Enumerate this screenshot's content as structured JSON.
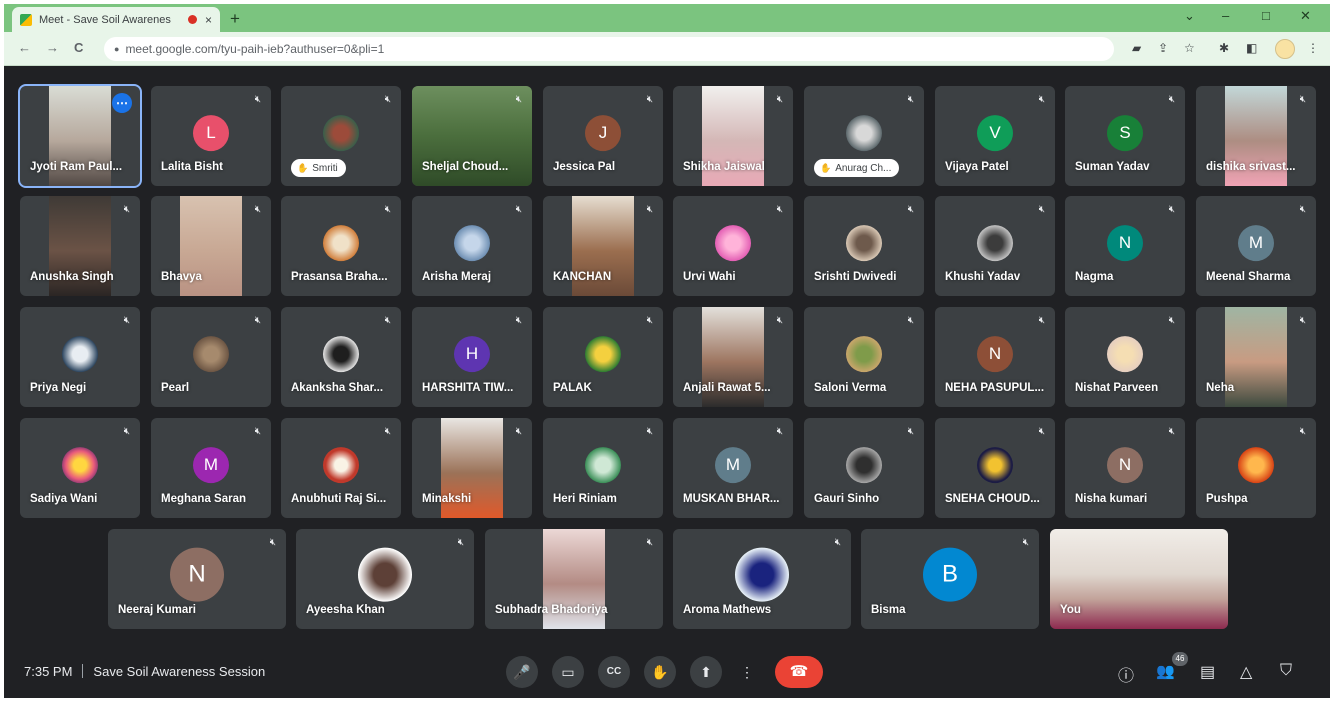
{
  "browser": {
    "tab_title": "Meet - Save Soil Awarenes",
    "url": "meet.google.com/tyu-paih-ieb?authuser=0&pli=1",
    "tab_close": "×",
    "new_tab": "+",
    "window_controls": {
      "collapse": "⌄",
      "minimize": "–",
      "maximize": "□",
      "close": "✕"
    },
    "nav": {
      "back": "←",
      "forward": "→",
      "reload": "C"
    },
    "toolbar_icons": {
      "cast": "▰",
      "share": "⇪",
      "bookmark": "☆",
      "extensions": "✱",
      "sidepanel": "◧",
      "menu": "⋮"
    }
  },
  "participants": [
    {
      "name": "Jyoti Ram Paul...",
      "kind": "video",
      "bg": "linear-gradient(180deg,#d9dcd5,#b6a89c 55%,#514844)",
      "active": true
    },
    {
      "name": "Lalita Bisht",
      "kind": "avatar",
      "initial": "L",
      "color": "#e8506b"
    },
    {
      "name": "Smriti",
      "kind": "photo-pill",
      "bg": "radial-gradient(circle,#9c4b3a 30%,#3a5f4a 70%)"
    },
    {
      "name": "Sheljal Choud...",
      "kind": "video-full",
      "bg": "linear-gradient(180deg,#6d8f5e,#4b6e3d 50%,#2f4b28)"
    },
    {
      "name": "Jessica Pal",
      "kind": "avatar",
      "initial": "J",
      "color": "#8d4f37"
    },
    {
      "name": "Shikha Jaiswal",
      "kind": "video",
      "bg": "linear-gradient(180deg,#f1f0ee,#d4b7b6 55%,#e8a9b6)"
    },
    {
      "name": "Anurag Ch...",
      "kind": "photo-pill",
      "bg": "radial-gradient(circle,#d8d8d8 30%,#5e6a6e 70%)"
    },
    {
      "name": "Vijaya Patel",
      "kind": "avatar",
      "initial": "V",
      "color": "#0f9d58"
    },
    {
      "name": "Suman Yadav",
      "kind": "avatar",
      "initial": "S",
      "color": "#188038"
    },
    {
      "name": "dishika srivast...",
      "kind": "video",
      "bg": "linear-gradient(180deg,#c2d7d8,#ad8d82 55%,#f0a3b5)"
    },
    {
      "name": "Anushka Singh",
      "kind": "video",
      "bg": "linear-gradient(180deg,#3f3a36,#6b5346 55%,#2b2624)"
    },
    {
      "name": "Bhavya",
      "kind": "video",
      "bg": "linear-gradient(180deg,#d8c2b0,#c8a894 55%,#b99283)"
    },
    {
      "name": "Prasansa Braha...",
      "kind": "photo",
      "bg": "radial-gradient(circle,#f0e1c8 30%,#d17f3c 70%)"
    },
    {
      "name": "Arisha Meraj",
      "kind": "photo",
      "bg": "radial-gradient(circle,#c5d6ea 30%,#6e8fb3 70%)"
    },
    {
      "name": "KANCHAN",
      "kind": "video",
      "bg": "linear-gradient(180deg,#e6ddd0,#9b6e4f 55%,#6b4a38)"
    },
    {
      "name": "Urvi Wahi",
      "kind": "photo",
      "bg": "radial-gradient(circle,#ffb3d9 30%,#e35fb4 70%)"
    },
    {
      "name": "Srishti Dwivedi",
      "kind": "photo",
      "bg": "radial-gradient(circle,#6e5a4c 30%,#d8c7b4 70%)"
    },
    {
      "name": "Khushi Yadav",
      "kind": "photo",
      "bg": "radial-gradient(circle,#3c3c3c 30%,#c3c3c3 70%)"
    },
    {
      "name": "Nagma",
      "kind": "avatar",
      "initial": "N",
      "color": "#00897b"
    },
    {
      "name": "Meenal Sharma",
      "kind": "avatar",
      "initial": "M",
      "color": "#607d8b"
    },
    {
      "name": "Priya Negi",
      "kind": "photo",
      "bg": "radial-gradient(circle,#e8edf2 30%,#2d4660 70%)"
    },
    {
      "name": "Pearl",
      "kind": "photo",
      "bg": "radial-gradient(circle,#a68a6d 30%,#6d5644 70%)"
    },
    {
      "name": "Akanksha Shar...",
      "kind": "photo",
      "bg": "radial-gradient(circle,#1e1e1e 30%,#e3e3e3 70%)"
    },
    {
      "name": "HARSHITA TIW...",
      "kind": "avatar",
      "initial": "H",
      "color": "#5e35b1"
    },
    {
      "name": "PALAK",
      "kind": "photo",
      "bg": "radial-gradient(circle,#f4d03f 30%,#2e7d32 70%)"
    },
    {
      "name": "Anjali Rawat 5...",
      "kind": "video",
      "bg": "linear-gradient(180deg,#e3e0db,#9d7560 55%,#2c2c2c)"
    },
    {
      "name": "Saloni Verma",
      "kind": "photo",
      "bg": "radial-gradient(circle,#7f9b4a 30%,#c9a66b 70%)"
    },
    {
      "name": "NEHA PASUPUL...",
      "kind": "avatar",
      "initial": "N",
      "color": "#8d4f37"
    },
    {
      "name": "Nishat Parveen",
      "kind": "photo",
      "bg": "radial-gradient(circle,#f5deb3 30%,#e6cfc0 70%)"
    },
    {
      "name": "Neha",
      "kind": "video",
      "bg": "linear-gradient(180deg,#9fb5a3,#c89b82 55%,#3d4a3f)"
    },
    {
      "name": "Sadiya Wani",
      "kind": "photo",
      "bg": "radial-gradient(circle,#ffd740 25%,#e95b7c 55%,#6a2c70 80%)"
    },
    {
      "name": "Meghana Saran",
      "kind": "avatar",
      "initial": "M",
      "color": "#9c27b0"
    },
    {
      "name": "Anubhuti Raj Si...",
      "kind": "photo",
      "bg": "radial-gradient(circle,#f9f3e6 25%,#c0392b 60%)"
    },
    {
      "name": "Minakshi",
      "kind": "video",
      "bg": "linear-gradient(180deg,#e9e6e2,#9b7258 55%,#e0592a)"
    },
    {
      "name": "Heri Riniam",
      "kind": "photo",
      "bg": "radial-gradient(circle,#cfe8d5 30%,#3b8f58 70%)"
    },
    {
      "name": "MUSKAN BHAR...",
      "kind": "avatar",
      "initial": "M",
      "color": "#607d8b"
    },
    {
      "name": "Gauri Sinho",
      "kind": "photo",
      "bg": "radial-gradient(circle,#2f2f2f 30%,#a7a7a7 70%)"
    },
    {
      "name": "SNEHA CHOUD...",
      "kind": "photo",
      "bg": "radial-gradient(circle,#f2c230 25%,#1c1c44 65%)"
    },
    {
      "name": "Nisha kumari",
      "kind": "avatar",
      "initial": "N",
      "color": "#8d6e63"
    },
    {
      "name": "Pushpa",
      "kind": "photo",
      "bg": "radial-gradient(circle,#ffb74d 30%,#d84315 70%)"
    },
    {
      "name": "Neeraj Kumari",
      "kind": "avatar",
      "initial": "N",
      "color": "#8d6e63"
    },
    {
      "name": "Ayeesha Khan",
      "kind": "photo",
      "bg": "radial-gradient(circle,#5d4037 30%,#ffffff 70%)"
    },
    {
      "name": "Subhadra Bhadoriya",
      "kind": "video",
      "bg": "linear-gradient(180deg,#ecd8d6,#b38b84 55%,#dfe3ea)"
    },
    {
      "name": "Aroma Mathews",
      "kind": "photo",
      "bg": "radial-gradient(circle,#1a237e 30%,#e8f1f7 70%)"
    },
    {
      "name": "Bisma",
      "kind": "avatar",
      "initial": "B",
      "color": "#0288d1"
    },
    {
      "name": "You",
      "kind": "video-full",
      "bg": "linear-gradient(180deg,#f1ede8,#e0d7cf 45%,#c2a39a 70%,#8d2a4f)"
    }
  ],
  "bottom_bar": {
    "time": "7:35 PM",
    "meeting_title": "Save Soil Awareness Session",
    "controls": {
      "mic": "🎤",
      "camera": "▭",
      "captions": "CC",
      "raise_hand": "✋",
      "present": "⬆",
      "more": "⋮",
      "hangup": "☎"
    },
    "right": {
      "info": "ⓘ",
      "people": "👥",
      "chat": "▤",
      "activities": "△",
      "host": "⛉"
    },
    "participant_count": "46"
  },
  "icons": {
    "mute": "🎙︎",
    "more_options": "•••",
    "pill_icon": "✋"
  }
}
